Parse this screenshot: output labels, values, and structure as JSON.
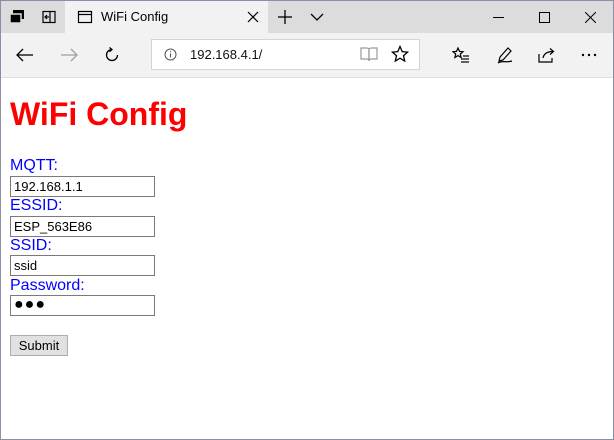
{
  "browser": {
    "tab": {
      "title": "WiFi Config"
    },
    "address": "192.168.4.1/",
    "icons": {
      "tab_sets": "tab-sets-icon",
      "set_aside": "set-aside-icon",
      "page": "page-icon",
      "tab_close": "close-icon",
      "new_tab": "plus-icon",
      "tab_menu": "chevron-down-icon",
      "minimize": "minimize-icon",
      "maximize": "maximize-icon",
      "close": "close-icon",
      "back": "arrow-left-icon",
      "forward": "arrow-right-icon",
      "refresh": "refresh-icon",
      "info": "info-icon",
      "reading_view": "book-icon",
      "favorite": "star-icon",
      "favorites_hub": "favorites-list-icon",
      "notes": "pen-icon",
      "share": "share-icon"
    }
  },
  "page": {
    "title": "WiFi Config",
    "title_color": "#ff0000",
    "label_color": "#0000ff",
    "fields": [
      {
        "label": "MQTT:",
        "value": "192.168.1.1"
      },
      {
        "label": "ESSID:",
        "value": "ESP_563E86"
      },
      {
        "label": "SSID:",
        "value": "ssid"
      },
      {
        "label": "Password:",
        "value": "●●●"
      }
    ],
    "submit_label": "Submit"
  }
}
